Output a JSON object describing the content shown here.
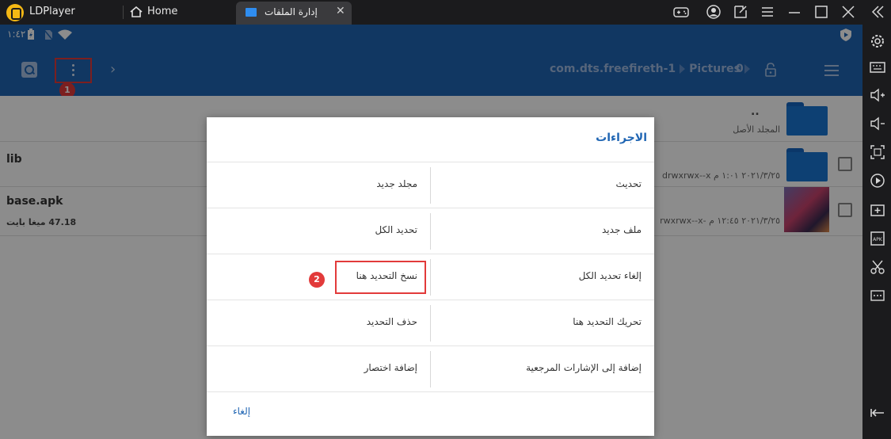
{
  "window": {
    "app_name": "LDPlayer",
    "home_tab_label": "Home",
    "active_tab_label": "إدارة الملفات",
    "close_glyph": "✕"
  },
  "statusbar": {
    "time": "١:٤٢"
  },
  "appbar": {
    "path_segments": [
      "com.dts.freefireth-1",
      "Pictures"
    ],
    "selected_count": "0",
    "chevron_glyph": "›"
  },
  "files": [
    {
      "name": "..",
      "subtitle": "المجلد الأصل",
      "type": "folder"
    },
    {
      "name": "lib",
      "meta": "drwxrwx--x   ٢٠٢١/٣/٢٥ ١:٠١ م",
      "type": "folder"
    },
    {
      "name": "base.apk",
      "size": "47.18 ميغا بايت",
      "meta": "rwxrwx--x-   ٢٠٢١/٣/٢٥ ١٢:٤٥ م",
      "type": "file"
    }
  ],
  "dialog": {
    "title": "الاجراءات",
    "rows": [
      {
        "right": "تحديث",
        "left": "مجلد جديد"
      },
      {
        "right": "ملف جديد",
        "left": "تحديد الكل"
      },
      {
        "right": "إلغاء تحديد الكل",
        "left": "نسخ التحديد هنا"
      },
      {
        "right": "تحريك التحديد هنا",
        "left": "حذف التحديد"
      },
      {
        "right": "إضافة إلى الإشارات المرجعية",
        "left": "إضافة اختصار"
      }
    ],
    "cancel_label": "إلغاء"
  },
  "annotations": {
    "step1": "1",
    "step2": "2",
    "highlight_color": "#e23a3a"
  },
  "colors": {
    "app_blue": "#1f65b3",
    "folder_blue": "#1976d2",
    "emulator_dark": "#1b1b1d"
  },
  "right_toolbar_icons": [
    "collapse-icon",
    "settings-icon",
    "keyboard-icon",
    "volume-up-icon",
    "volume-down-icon",
    "fullscreen-icon",
    "record-icon",
    "add-window-icon",
    "apk-install-icon",
    "scissors-icon",
    "more-icon",
    "back-icon"
  ]
}
